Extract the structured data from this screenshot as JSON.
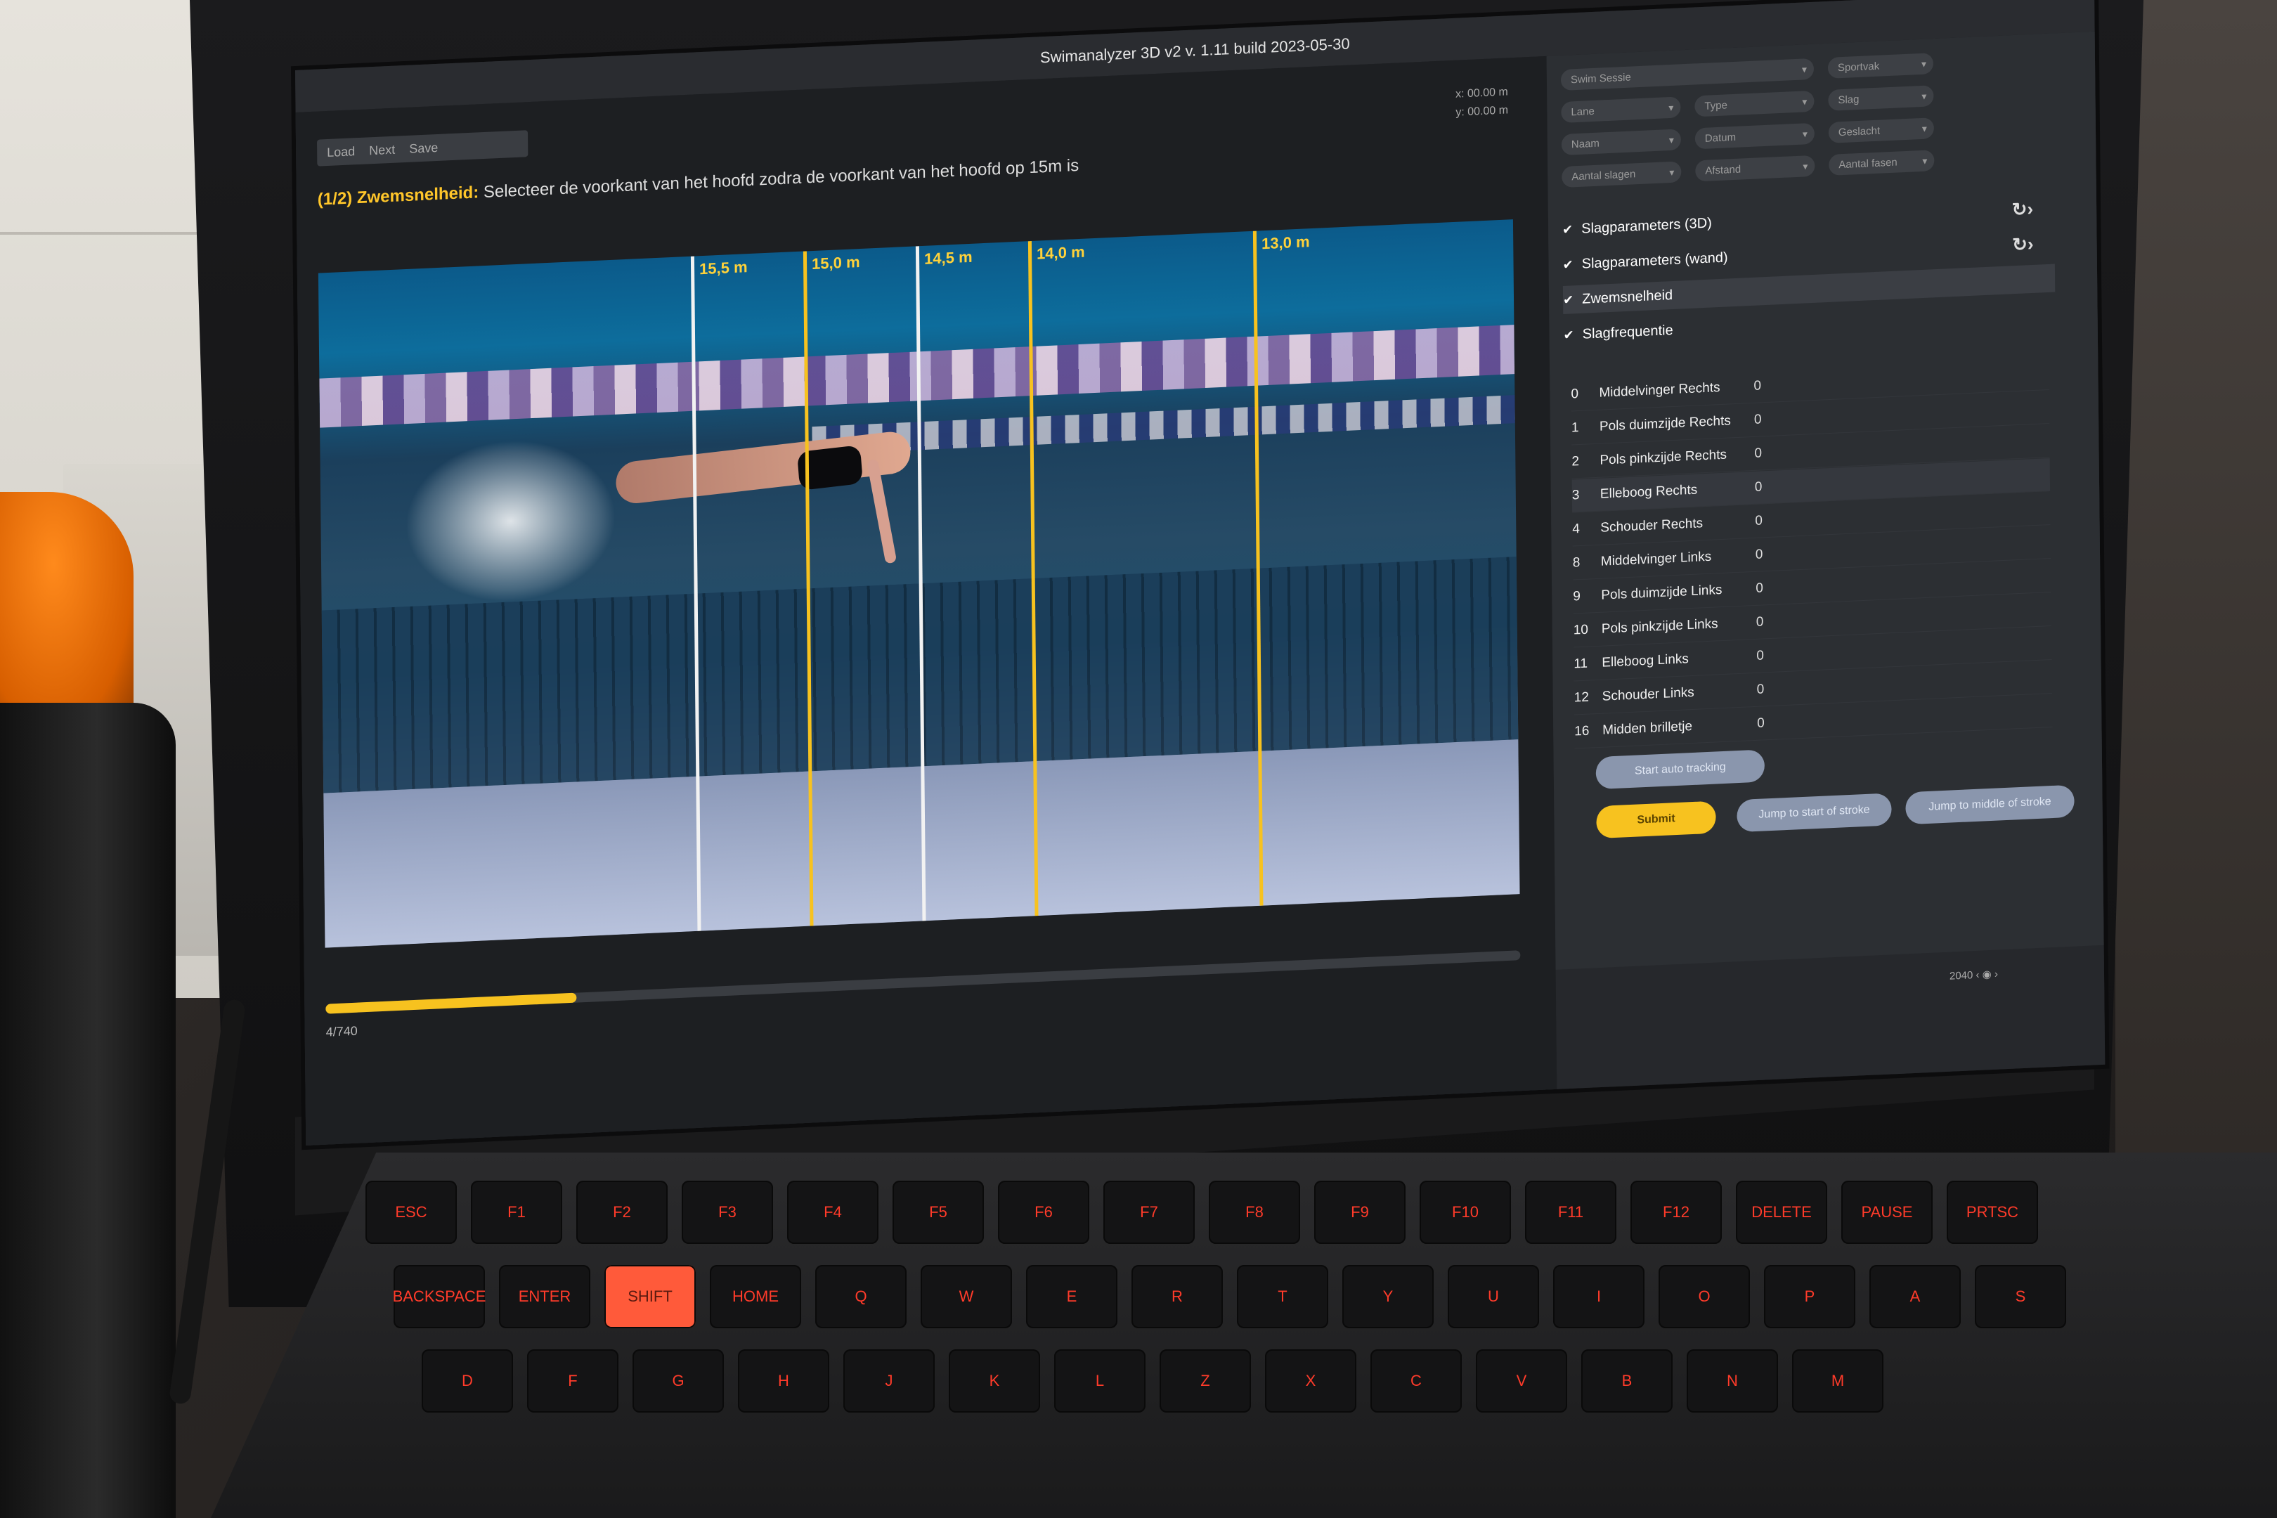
{
  "window": {
    "title": "Swimanalyzer 3D v2 v. 1.11 build 2023-05-30"
  },
  "toolbar": {
    "crumbs": [
      "Load",
      "Next",
      "Save"
    ]
  },
  "instruction": {
    "prefix": "(1/2) Zwemsnelheid:",
    "text": "Selecteer de voorkant van het hoofd zodra de voorkant van het hoofd op 15m is"
  },
  "coords": {
    "x": "x:  00.00 m",
    "y": "y:  00.00 m"
  },
  "distance_markers": [
    {
      "label": "15,5 m",
      "color": "white"
    },
    {
      "label": "15,0 m",
      "color": "yellow"
    },
    {
      "label": "14,5 m",
      "color": "white"
    },
    {
      "label": "14,0 m",
      "color": "yellow"
    },
    {
      "label": "13,0 m",
      "color": "yellow"
    }
  ],
  "timeline": {
    "frame": "4/740",
    "progress": 0.21
  },
  "filters": [
    "Swim Sessie",
    "Sportvak",
    "Lane",
    "Type",
    "Slag",
    "Naam",
    "Datum",
    "Geslacht",
    "Aantal slagen",
    "Afstand",
    "Aantal fasen"
  ],
  "sections": [
    {
      "label": "Slagparameters (3D)",
      "checked": true,
      "refresh": true
    },
    {
      "label": "Slagparameters (wand)",
      "checked": true,
      "refresh": true
    },
    {
      "label": "Zwemsnelheid",
      "checked": true,
      "active": true
    },
    {
      "label": "Slagfrequentie",
      "checked": true
    }
  ],
  "keypoints": [
    {
      "idx": "0",
      "name": "Middelvinger Rechts",
      "value": "0"
    },
    {
      "idx": "1",
      "name": "Pols duimzijde Rechts",
      "value": "0"
    },
    {
      "idx": "2",
      "name": "Pols pinkzijde Rechts",
      "value": "0"
    },
    {
      "idx": "3",
      "name": "Elleboog Rechts",
      "value": "0"
    },
    {
      "idx": "4",
      "name": "Schouder Rechts",
      "value": "0"
    },
    {
      "idx": "8",
      "name": "Middelvinger Links",
      "value": "0"
    },
    {
      "idx": "9",
      "name": "Pols duimzijde Links",
      "value": "0"
    },
    {
      "idx": "10",
      "name": "Pols pinkzijde Links",
      "value": "0"
    },
    {
      "idx": "11",
      "name": "Elleboog Links",
      "value": "0"
    },
    {
      "idx": "12",
      "name": "Schouder Links",
      "value": "0"
    },
    {
      "idx": "16",
      "name": "Midden brilletje",
      "value": "0"
    }
  ],
  "buttons": {
    "auto_tracking": "Start auto tracking",
    "jump_start": "Jump to start of stroke",
    "jump_middle": "Jump to middle of stroke",
    "submit": "Submit"
  },
  "pager": {
    "label": "2040"
  },
  "keyboard": {
    "keys": [
      "ESC",
      "F1",
      "F2",
      "F3",
      "F4",
      "F5",
      "F6",
      "F7",
      "F8",
      "F9",
      "F10",
      "F11",
      "F12",
      "DELETE",
      "PAUSE",
      "PRTSC",
      "BACKSPACE",
      "ENTER",
      "SHIFT",
      "HOME",
      "Q",
      "W",
      "E",
      "R",
      "T",
      "Y",
      "U",
      "I",
      "O",
      "P",
      "A",
      "S",
      "D",
      "F",
      "G",
      "H",
      "J",
      "K",
      "L",
      "Z",
      "X",
      "C",
      "V",
      "B",
      "N",
      "M"
    ]
  }
}
